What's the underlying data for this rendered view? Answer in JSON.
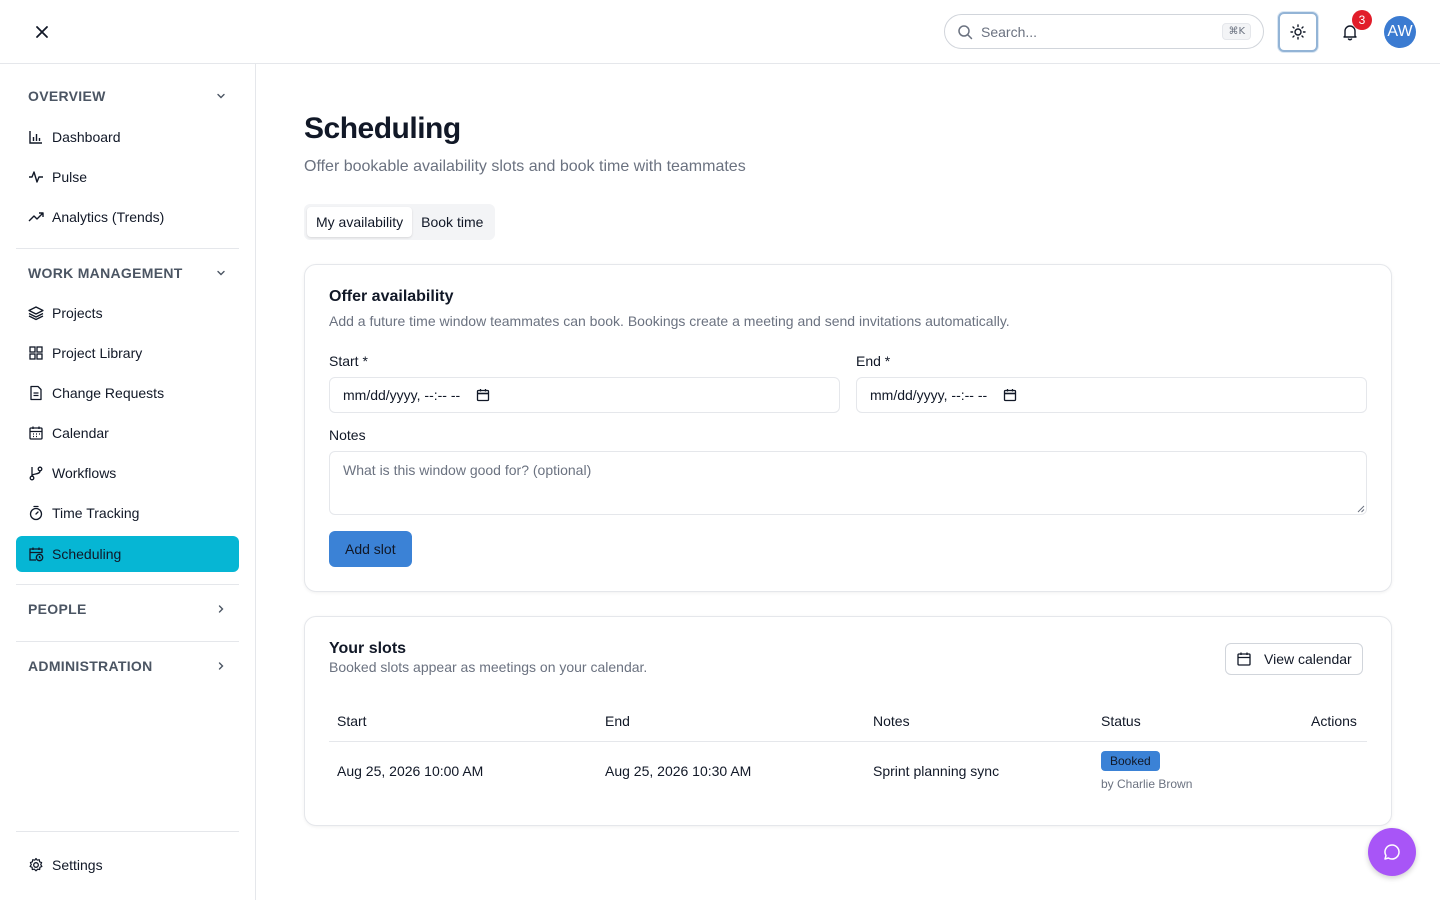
{
  "topbar": {
    "search_placeholder": "Search...",
    "search_shortcut": "⌘K",
    "notification_count": "3",
    "avatar_initials": "AW"
  },
  "sidebar": {
    "sections": [
      {
        "label": "OVERVIEW",
        "expanded": true,
        "items": [
          "Dashboard",
          "Pulse",
          "Analytics (Trends)"
        ]
      },
      {
        "label": "WORK MANAGEMENT",
        "expanded": true,
        "items": [
          "Projects",
          "Project Library",
          "Change Requests",
          "Calendar",
          "Workflows",
          "Time Tracking",
          "Scheduling"
        ]
      },
      {
        "label": "PEOPLE",
        "expanded": false,
        "items": []
      },
      {
        "label": "ADMINISTRATION",
        "expanded": false,
        "items": []
      }
    ],
    "active_item": "Scheduling",
    "settings_label": "Settings"
  },
  "page": {
    "title": "Scheduling",
    "subtitle": "Offer bookable availability slots and book time with teammates",
    "tabs": [
      {
        "label": "My availability",
        "active": true
      },
      {
        "label": "Book time",
        "active": false
      }
    ]
  },
  "offer": {
    "title": "Offer availability",
    "description": "Add a future time window teammates can book. Bookings create a meeting and send invitations automatically.",
    "start_label": "Start *",
    "start_value": "mm/dd/yyyy, --:-- --",
    "end_label": "End *",
    "end_value": "mm/dd/yyyy, --:-- --",
    "notes_label": "Notes",
    "notes_placeholder": "What is this window good for? (optional)",
    "add_button": "Add slot"
  },
  "slots": {
    "title": "Your slots",
    "description": "Booked slots appear as meetings on your calendar.",
    "view_calendar": "View calendar",
    "columns": [
      "Start",
      "End",
      "Notes",
      "Status",
      "Actions"
    ],
    "rows": [
      {
        "start": "Aug 25, 2026 10:00 AM",
        "end": "Aug 25, 2026 10:30 AM",
        "notes": "Sprint planning sync",
        "status": "Booked",
        "booked_by": "by Charlie Brown"
      }
    ]
  },
  "colors": {
    "accent": "#06b6d4",
    "primary_button": "#3b82d6",
    "badge": "#e11d2a",
    "chat_fab": "#a855f7"
  }
}
